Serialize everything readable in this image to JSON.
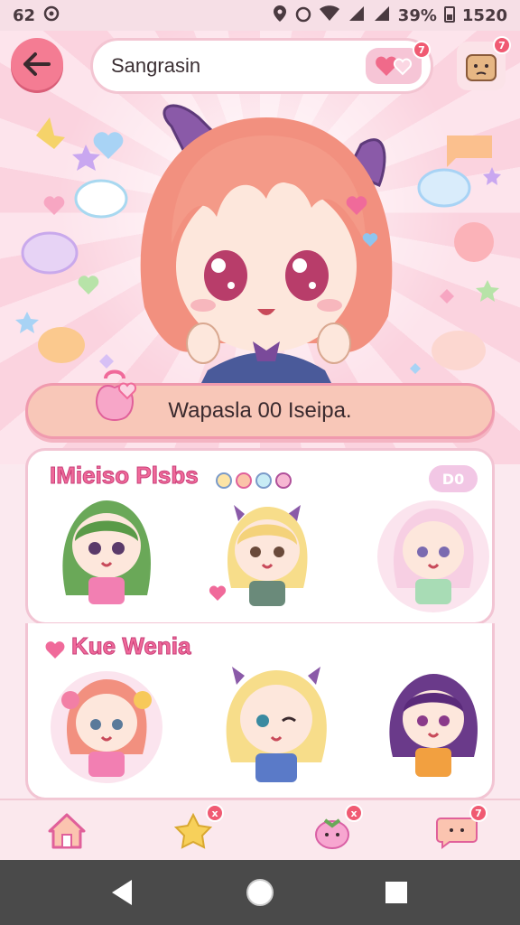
{
  "status_bar": {
    "time_left": "62",
    "battery_percent": "39%",
    "clock": "1520"
  },
  "header": {
    "search_value": "Sangrasin",
    "heart_badge": "7",
    "profile_badge": "7"
  },
  "banner": {
    "text": "Wapasla 00 Iseipa."
  },
  "section_1": {
    "title": "IMieiso Plsbs",
    "count_label": "D0",
    "characters": [
      "green-hair-girl",
      "blonde-bow-girl",
      "pink-hair-girl"
    ]
  },
  "section_2": {
    "title": "Kue Wenia",
    "characters": [
      "red-flower-girl",
      "blonde-wink-girl",
      "purple-hair-girl"
    ]
  },
  "bottom_nav": {
    "items": [
      "home-icon",
      "star-icon",
      "strawberry-icon",
      "chat-icon"
    ],
    "badges": [
      "",
      "x",
      "x",
      "7"
    ]
  },
  "colors": {
    "accent": "#f06a9a",
    "back_button": "#f47c93",
    "banner": "#f8c7b8",
    "panel_border": "#f2c4d3"
  }
}
